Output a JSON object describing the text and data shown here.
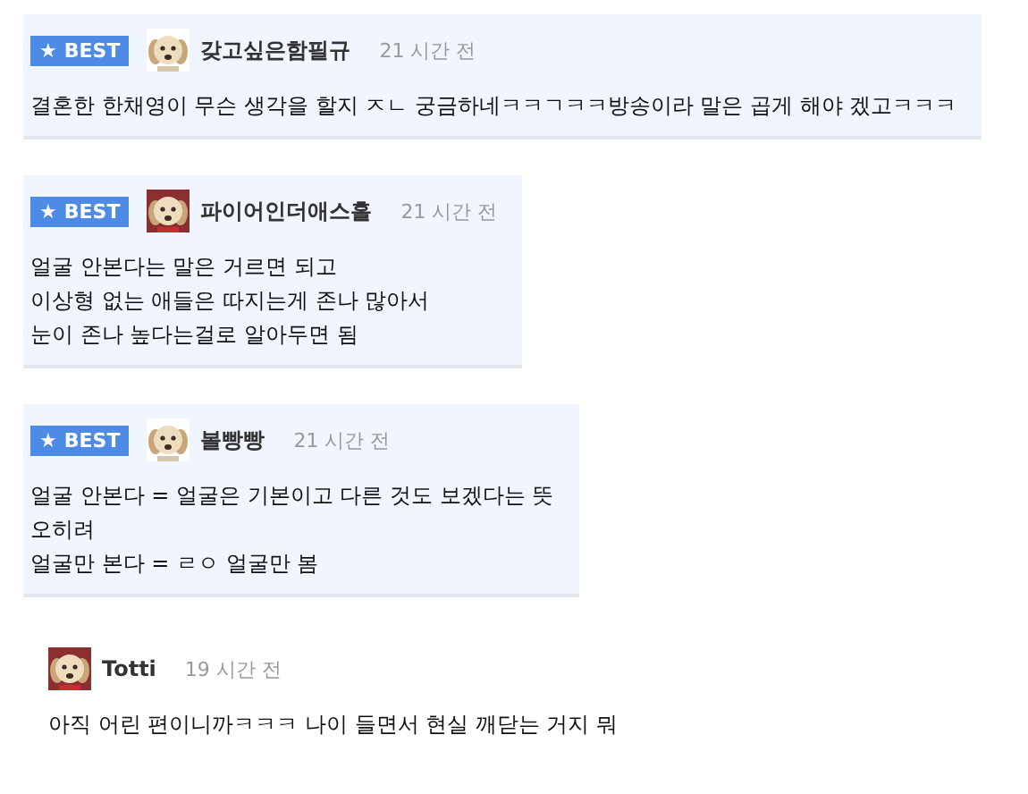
{
  "comments": [
    {
      "best": true,
      "badge": "BEST",
      "badge_icon": "★",
      "avatar": {
        "kind": "picture"
      },
      "author": "갖고싶은함필규",
      "time": "21 시간 전",
      "lines": [
        "결혼한 한채영이 무슨 생각을 할지 ㅈㄴ 궁금하네ㅋㅋㄱㅋㅋ방송이라 말은 곱게 해야 겠고ㅋㅋㅋ"
      ]
    },
    {
      "best": true,
      "badge": "BEST",
      "badge_icon": "★",
      "avatar": {
        "kind": "picture"
      },
      "author": "파이어인더애스홀",
      "time": "21 시간 전",
      "lines": [
        "얼굴 안본다는 말은 거르면 되고",
        "이상형 없는 애들은 따지는게 존나 많아서",
        "눈이 존나 높다는걸로 알아두면 됨"
      ]
    },
    {
      "best": true,
      "badge": "BEST",
      "badge_icon": "★",
      "avatar": {
        "kind": "picture"
      },
      "author": "볼빵빵",
      "time": "21 시간 전",
      "lines": [
        "얼굴 안본다 = 얼굴은 기본이고 다른 것도 보겠다는 뜻",
        "오히려",
        "얼굴만 본다 = ㄹㅇ 얼굴만 봄"
      ]
    },
    {
      "best": false,
      "avatar": {
        "kind": "picture"
      },
      "author": "Totti",
      "time": "19 시간 전",
      "lines": [
        "아직 어린 편이니까ㅋㅋㅋ 나이 들면서 현실 깨닫는 거지 뭐"
      ]
    }
  ]
}
